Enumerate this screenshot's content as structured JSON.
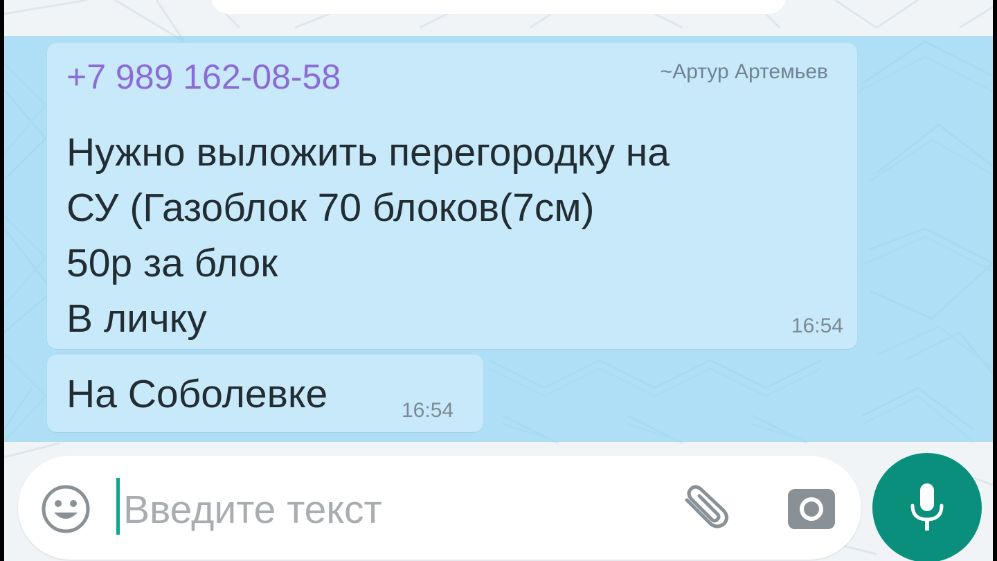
{
  "chat": {
    "messages": [
      {
        "sender_phone": "+7 989 162-08-58",
        "sender_name": "~Артур Артемьев",
        "lines": [
          "Нужно выложить перегородку на",
          "СУ (Газоблок 70 блоков(7см)",
          "50р за блок",
          "В личку"
        ],
        "time": "16:54"
      },
      {
        "text": "На Соболевке",
        "time": "16:54"
      }
    ]
  },
  "composer": {
    "placeholder": "Введите текст",
    "value": "",
    "emoji_icon": "smiley-icon",
    "attach_icon": "paperclip-icon",
    "camera_icon": "camera-icon",
    "mic_icon": "microphone-icon"
  },
  "colors": {
    "bubble": "#c8e9fa",
    "selection": "#78cdf5",
    "sender_phone": "#8c6bd6",
    "mic_button": "#0a8f7d",
    "cursor": "#0aa88f"
  }
}
